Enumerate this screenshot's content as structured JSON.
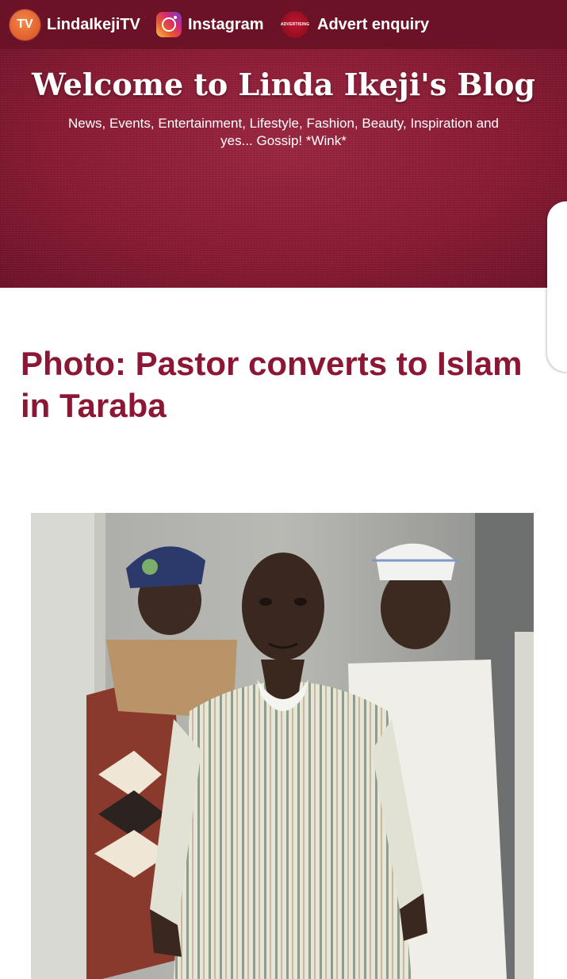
{
  "nav": {
    "tv": {
      "badge": "TV",
      "label": "LindaIkejiTV"
    },
    "instagram": {
      "label": "Instagram"
    },
    "advert": {
      "badge": "ADVERTISING",
      "label": "Advert enquiry"
    }
  },
  "header": {
    "title": "Welcome to Linda Ikeji's Blog",
    "tagline": "News, Events, Entertainment, Lifestyle, Fashion, Beauty, Inspiration and yes... Gossip! *Wink*"
  },
  "post": {
    "title": "Photo: Pastor converts to Islam in Taraba"
  },
  "colors": {
    "topbar": "#6b1226",
    "header": "#8e1c37",
    "post_title": "#8b1734",
    "tv_badge": "#e35d2a"
  },
  "icons": [
    "tv-icon",
    "instagram-icon",
    "advertising-icon"
  ]
}
